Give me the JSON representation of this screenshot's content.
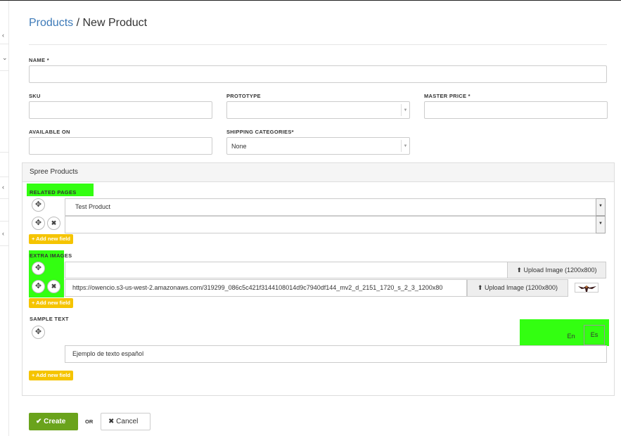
{
  "breadcrumb": {
    "parent": "Products",
    "separator": " / ",
    "current": "New Product"
  },
  "fields": {
    "name_label": "NAME",
    "sku_label": "SKU",
    "prototype_label": "PROTOTYPE",
    "master_price_label": "MASTER PRICE",
    "available_on_label": "AVAILABLE ON",
    "shipping_categories_label": "SHIPPING CATEGORIES",
    "shipping_categories_value": "None",
    "required_mark": "*"
  },
  "panel": {
    "title": "Spree Products",
    "related_pages": {
      "label": "RELATED PAGES",
      "rows": [
        "Test Product",
        ""
      ],
      "add_label": "+ Add new field"
    },
    "extra_images": {
      "label": "EXTRA IMAGES",
      "rows": [
        "",
        "https://owencio.s3-us-west-2.amazonaws.com/319299_086c5c421f3144108014d9c7940df144_mv2_d_2151_1720_s_2_3_1200x80"
      ],
      "upload_label": "Upload Image (1200x800)",
      "add_label": "+ Add new field"
    },
    "sample_text": {
      "label": "SAMPLE TEXT",
      "lang_en": "En",
      "lang_es": "Es",
      "value": "Ejemplo de texto español",
      "add_label": "+ Add new field"
    }
  },
  "actions": {
    "create_label": "Create",
    "or_label": "OR",
    "cancel_label": "Cancel"
  },
  "colors": {
    "link": "#3d7ab8",
    "create": "#6aa31c",
    "add_field": "#f5c400",
    "highlight": "#33ff11"
  },
  "icons": [
    "move-icon",
    "remove-icon",
    "upload-icon",
    "check-icon",
    "close-icon",
    "chevron-left-icon",
    "chevron-down-icon",
    "image-thumbnail"
  ]
}
